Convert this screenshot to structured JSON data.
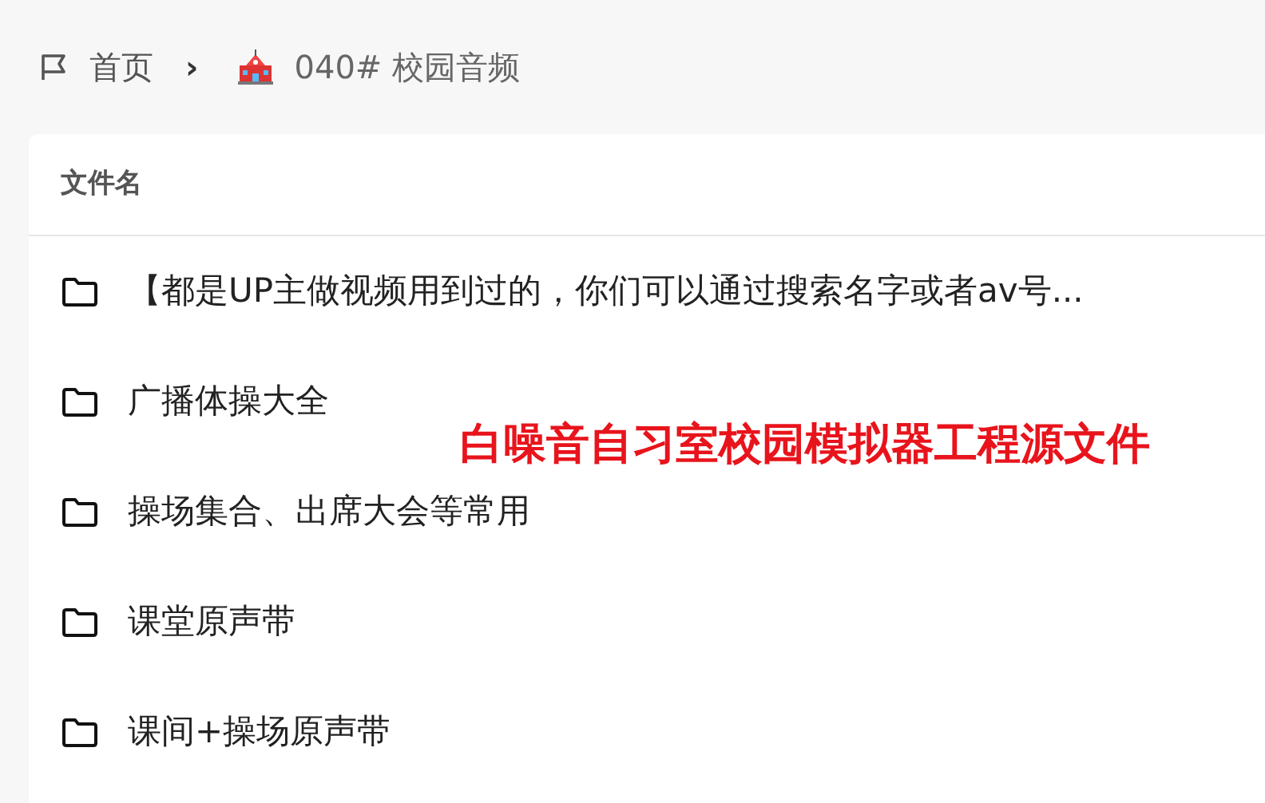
{
  "breadcrumb": {
    "home": "首页",
    "separator": "›",
    "current": "040# 校园音频"
  },
  "table": {
    "columns": [
      "文件名"
    ],
    "rows": [
      {
        "name": "【都是UP主做视频用到过的，你们可以通过搜索名字或者av号..."
      },
      {
        "name": "广播体操大全"
      },
      {
        "name": "操场集合、出席大会等常用"
      },
      {
        "name": "课堂原声带"
      },
      {
        "name": "课间+操场原声带"
      }
    ]
  },
  "overlay_caption": "白噪音自习室校园模拟器工程源文件"
}
